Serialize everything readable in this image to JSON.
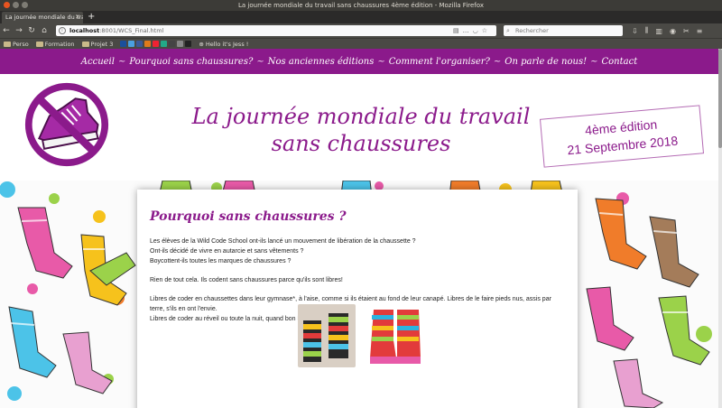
{
  "window": {
    "title": "La journée mondiale du travail sans chaussures 4ème édition - Mozilla Firefox"
  },
  "browser": {
    "tab_title": "La journée mondiale du tra",
    "url_host": "localhost",
    "url_path": ":8001/WCS_Final.html",
    "search_placeholder": "Rechercher"
  },
  "bookmarks": [
    {
      "label": "Perso",
      "type": "folder"
    },
    {
      "label": "Formation",
      "type": "folder"
    },
    {
      "label": "Projet 3",
      "type": "folder"
    },
    {
      "label": "Hello it's Jess !",
      "type": "link"
    }
  ],
  "menu": {
    "items": [
      "Accueil",
      "Pourquoi sans chaussures?",
      "Nos anciennes éditions",
      "Comment l'organiser?",
      "On parle de nous!",
      "Contact"
    ],
    "separator": "~"
  },
  "header": {
    "title_line1": "La journée mondiale du travail",
    "title_line2": "sans chaussures",
    "edition": "4ème édition",
    "date": "21 Septembre 2018"
  },
  "article": {
    "heading": "Pourquoi sans chaussures ?",
    "p1": [
      "Les élèves de la Wild Code School ont-ils lancé un mouvement de libération de la chaussette ?",
      "Ont-ils décidé de vivre en autarcie et sans vêtements ?",
      "Boycottent-ils toutes les marques de chaussures ?"
    ],
    "p2": "Rien de tout cela. Ils codent sans chaussures parce qu'ils sont libres!",
    "p3": [
      "Libres de coder en chaussettes dans leur gymnase*, à l'aise, comme si ils étaient au fond de leur canapé. Libres de le faire pieds nus, assis par",
      "terre, s'ils en ont l'envie.",
      "Libres de coder au réveil ou toute la nuit, quand bon leur semble!"
    ]
  },
  "colors": {
    "brand_purple": "#8b1a8b",
    "card_bg": "#ffffff"
  }
}
